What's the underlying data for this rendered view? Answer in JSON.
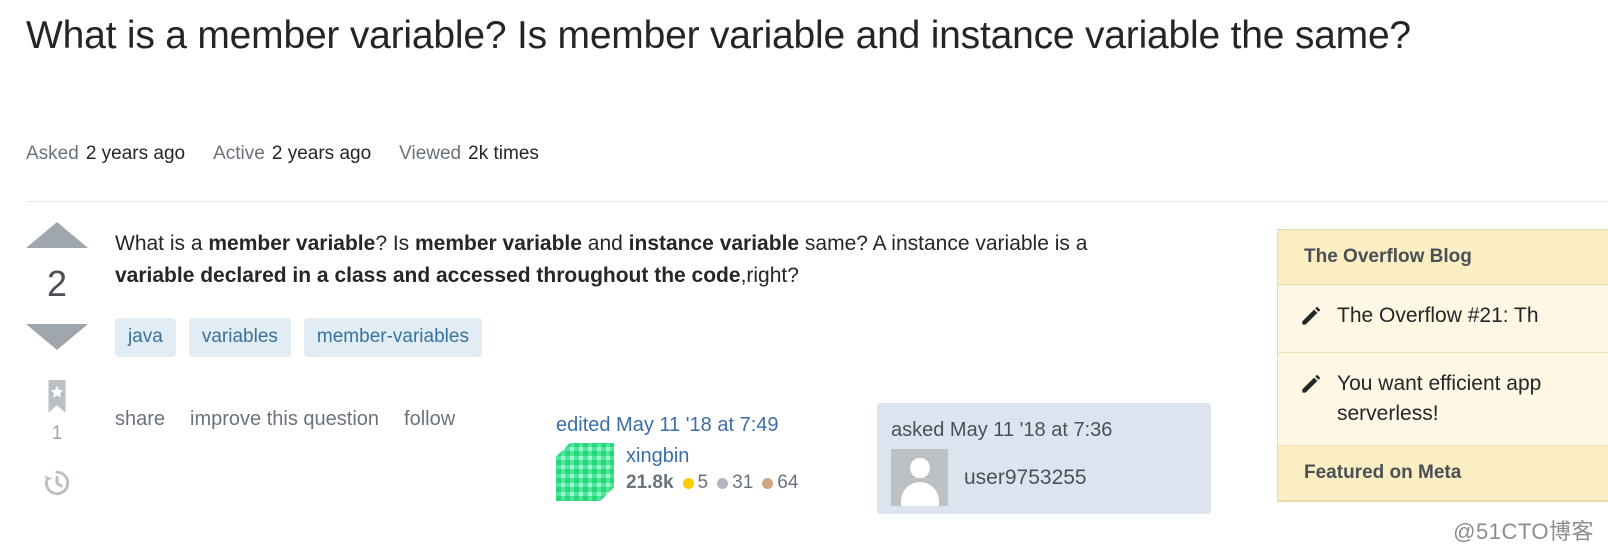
{
  "page": {
    "title": "What is a member variable? Is member variable and instance variable the same?",
    "watermark": "@51CTO博客"
  },
  "stats": [
    {
      "label": "Asked",
      "value": "2 years ago"
    },
    {
      "label": "Active",
      "value": "2 years ago"
    },
    {
      "label": "Viewed",
      "value": "2k times"
    }
  ],
  "vote": {
    "up_icon": "vote-up-arrow-icon",
    "down_icon": "vote-down-arrow-icon",
    "count": "2",
    "bookmark_icon": "bookmark-star-icon",
    "bookmark_count": "1",
    "history_icon": "history-clock-icon"
  },
  "post": {
    "body_segments": [
      {
        "text": "What is a ",
        "bold": false
      },
      {
        "text": "member variable",
        "bold": true
      },
      {
        "text": "? Is ",
        "bold": false
      },
      {
        "text": "member variable",
        "bold": true
      },
      {
        "text": " and ",
        "bold": false
      },
      {
        "text": "instance variable",
        "bold": true
      },
      {
        "text": " same? A instance variable is a ",
        "bold": false
      },
      {
        "text": "variable declared in a class and accessed throughout the code",
        "bold": true
      },
      {
        "text": ",right?",
        "bold": false
      }
    ],
    "tags": [
      "java",
      "variables",
      "member-variables"
    ],
    "actions": [
      "share",
      "improve this question",
      "follow"
    ]
  },
  "edited_signature": {
    "date": "edited May 11 '18 at 7:49",
    "avatar_icon": "identicon-avatar",
    "username": "xingbin",
    "reputation": "21.8k",
    "badges": [
      {
        "tier": "gold",
        "count": "5"
      },
      {
        "tier": "silver",
        "count": "31"
      },
      {
        "tier": "bronze",
        "count": "64"
      }
    ]
  },
  "asked_signature": {
    "date": "asked May 11 '18 at 7:36",
    "avatar_icon": "default-user-avatar",
    "username": "user9753255"
  },
  "sidebar": {
    "sections": [
      {
        "heading": "The Overflow Blog",
        "items": [
          {
            "icon": "pencil-icon",
            "label": "The Overflow #21: Th"
          },
          {
            "icon": "pencil-icon",
            "label": "You want efficient app\nserverless!"
          }
        ]
      },
      {
        "heading": "Featured on Meta",
        "items": []
      }
    ]
  },
  "colors": {
    "tag_bg": "#e1ecf4",
    "tag_text": "#39739d",
    "link": "#3b6ea8",
    "muted": "#6a737c",
    "sidebar_header_bg": "#fbeec2",
    "sidebar_body_bg": "#fdf7e3",
    "sidebar_border": "#e8d9a8",
    "asked_card_bg": "#dce5ef",
    "badge_gold": "#ffcc01",
    "badge_silver": "#b4b8bc",
    "badge_bronze": "#d1a684",
    "vote_arrow": "#9fa6ad"
  }
}
